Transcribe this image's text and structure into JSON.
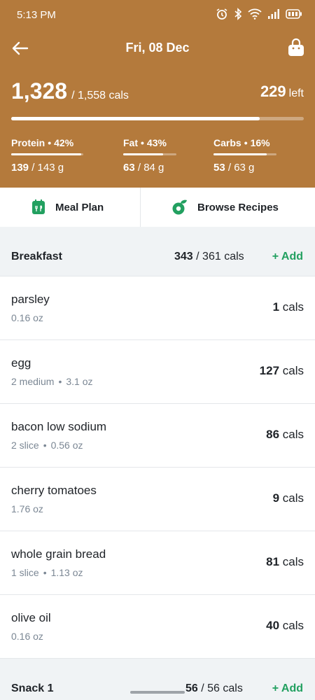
{
  "status_bar": {
    "time": "5:13 PM"
  },
  "header": {
    "date": "Fri, 08 Dec",
    "consumed": "1,328",
    "goal": "/ 1,558 cals",
    "remaining": "229",
    "remaining_label": "left",
    "progress": 0.85
  },
  "macros": [
    {
      "name": "Protein",
      "percent": "42%",
      "amount": "139",
      "goal": "/ 143 g",
      "progress": 0.97
    },
    {
      "name": "Fat",
      "percent": "43%",
      "amount": "63",
      "goal": "/ 84 g",
      "progress": 0.75
    },
    {
      "name": "Carbs",
      "percent": "16%",
      "amount": "53",
      "goal": "/ 63 g",
      "progress": 0.84
    }
  ],
  "shortcuts": {
    "meal_plan": "Meal Plan",
    "browse_recipes": "Browse Recipes"
  },
  "breakfast": {
    "title": "Breakfast",
    "eaten": "343",
    "goal": "/ 361 cals",
    "add_label": "+ Add",
    "items": [
      {
        "name": "parsley",
        "amount": "0.16 oz",
        "weight": "",
        "cals": "1",
        "unit": "cals"
      },
      {
        "name": "egg",
        "amount": "2 medium",
        "weight": "3.1 oz",
        "cals": "127",
        "unit": "cals"
      },
      {
        "name": "bacon low sodium",
        "amount": "2 slice",
        "weight": "0.56 oz",
        "cals": "86",
        "unit": "cals"
      },
      {
        "name": "cherry tomatoes",
        "amount": "1.76 oz",
        "weight": "",
        "cals": "9",
        "unit": "cals"
      },
      {
        "name": "whole grain bread",
        "amount": "1 slice",
        "weight": "1.13 oz",
        "cals": "81",
        "unit": "cals"
      },
      {
        "name": "olive oil",
        "amount": "0.16 oz",
        "weight": "",
        "cals": "40",
        "unit": "cals"
      }
    ]
  },
  "snack1": {
    "title": "Snack 1",
    "eaten": "56",
    "goal": "/ 56 cals",
    "add_label": "+ Add"
  }
}
